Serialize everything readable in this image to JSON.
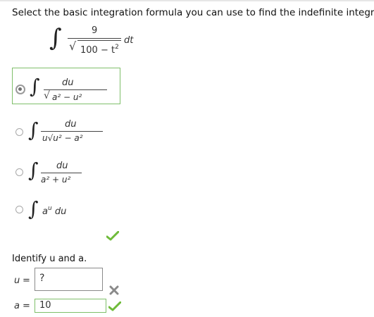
{
  "prompt": "Select the basic integration formula you can use to find the indefinite integral.",
  "problem": {
    "numerator": "9",
    "denominator_expr": "100 − t",
    "denominator_power": "2",
    "differential": "dt"
  },
  "choices": [
    {
      "numerator": "du",
      "denominator": "a² − u²",
      "selected": true
    },
    {
      "numerator": "du",
      "denominator": "u√u² − a²",
      "selected": false
    },
    {
      "numerator": "du",
      "denominator": "a² + u²",
      "selected": false
    },
    {
      "expression": "a",
      "exponent": "u",
      "differential": "du",
      "selected": false
    }
  ],
  "identify_text": "Identify u and a.",
  "u_field": {
    "label": "u",
    "value": "?"
  },
  "a_field": {
    "label": "a",
    "value": "10"
  },
  "status": {
    "choice": "correct",
    "u": "incorrect",
    "a": "correct"
  },
  "colors": {
    "correct": "#6fbb3a",
    "incorrect": "#8a8a8a",
    "selected_border": "#7fbf6a"
  }
}
